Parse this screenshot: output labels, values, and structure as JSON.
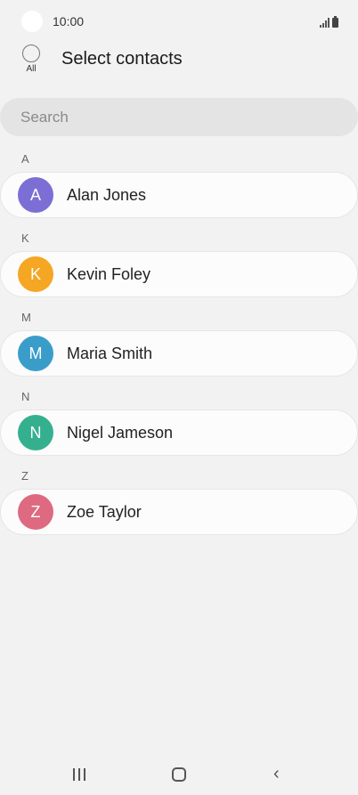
{
  "status_bar": {
    "time": "10:00"
  },
  "header": {
    "select_all_label": "All",
    "title": "Select contacts"
  },
  "search": {
    "placeholder": "Search"
  },
  "sections": [
    {
      "letter": "A",
      "contacts": [
        {
          "initial": "A",
          "name": "Alan Jones",
          "avatar_color": "#7b6fd6"
        }
      ]
    },
    {
      "letter": "K",
      "contacts": [
        {
          "initial": "K",
          "name": "Kevin Foley",
          "avatar_color": "#f5a623"
        }
      ]
    },
    {
      "letter": "M",
      "contacts": [
        {
          "initial": "M",
          "name": "Maria Smith",
          "avatar_color": "#3a9dc9"
        }
      ]
    },
    {
      "letter": "N",
      "contacts": [
        {
          "initial": "N",
          "name": "Nigel Jameson",
          "avatar_color": "#35b08e"
        }
      ]
    },
    {
      "letter": "Z",
      "contacts": [
        {
          "initial": "Z",
          "name": "Zoe Taylor",
          "avatar_color": "#dd6a80"
        }
      ]
    }
  ],
  "nav_bar": {
    "icons": [
      "recent-apps-icon",
      "home-icon",
      "back-icon"
    ]
  }
}
